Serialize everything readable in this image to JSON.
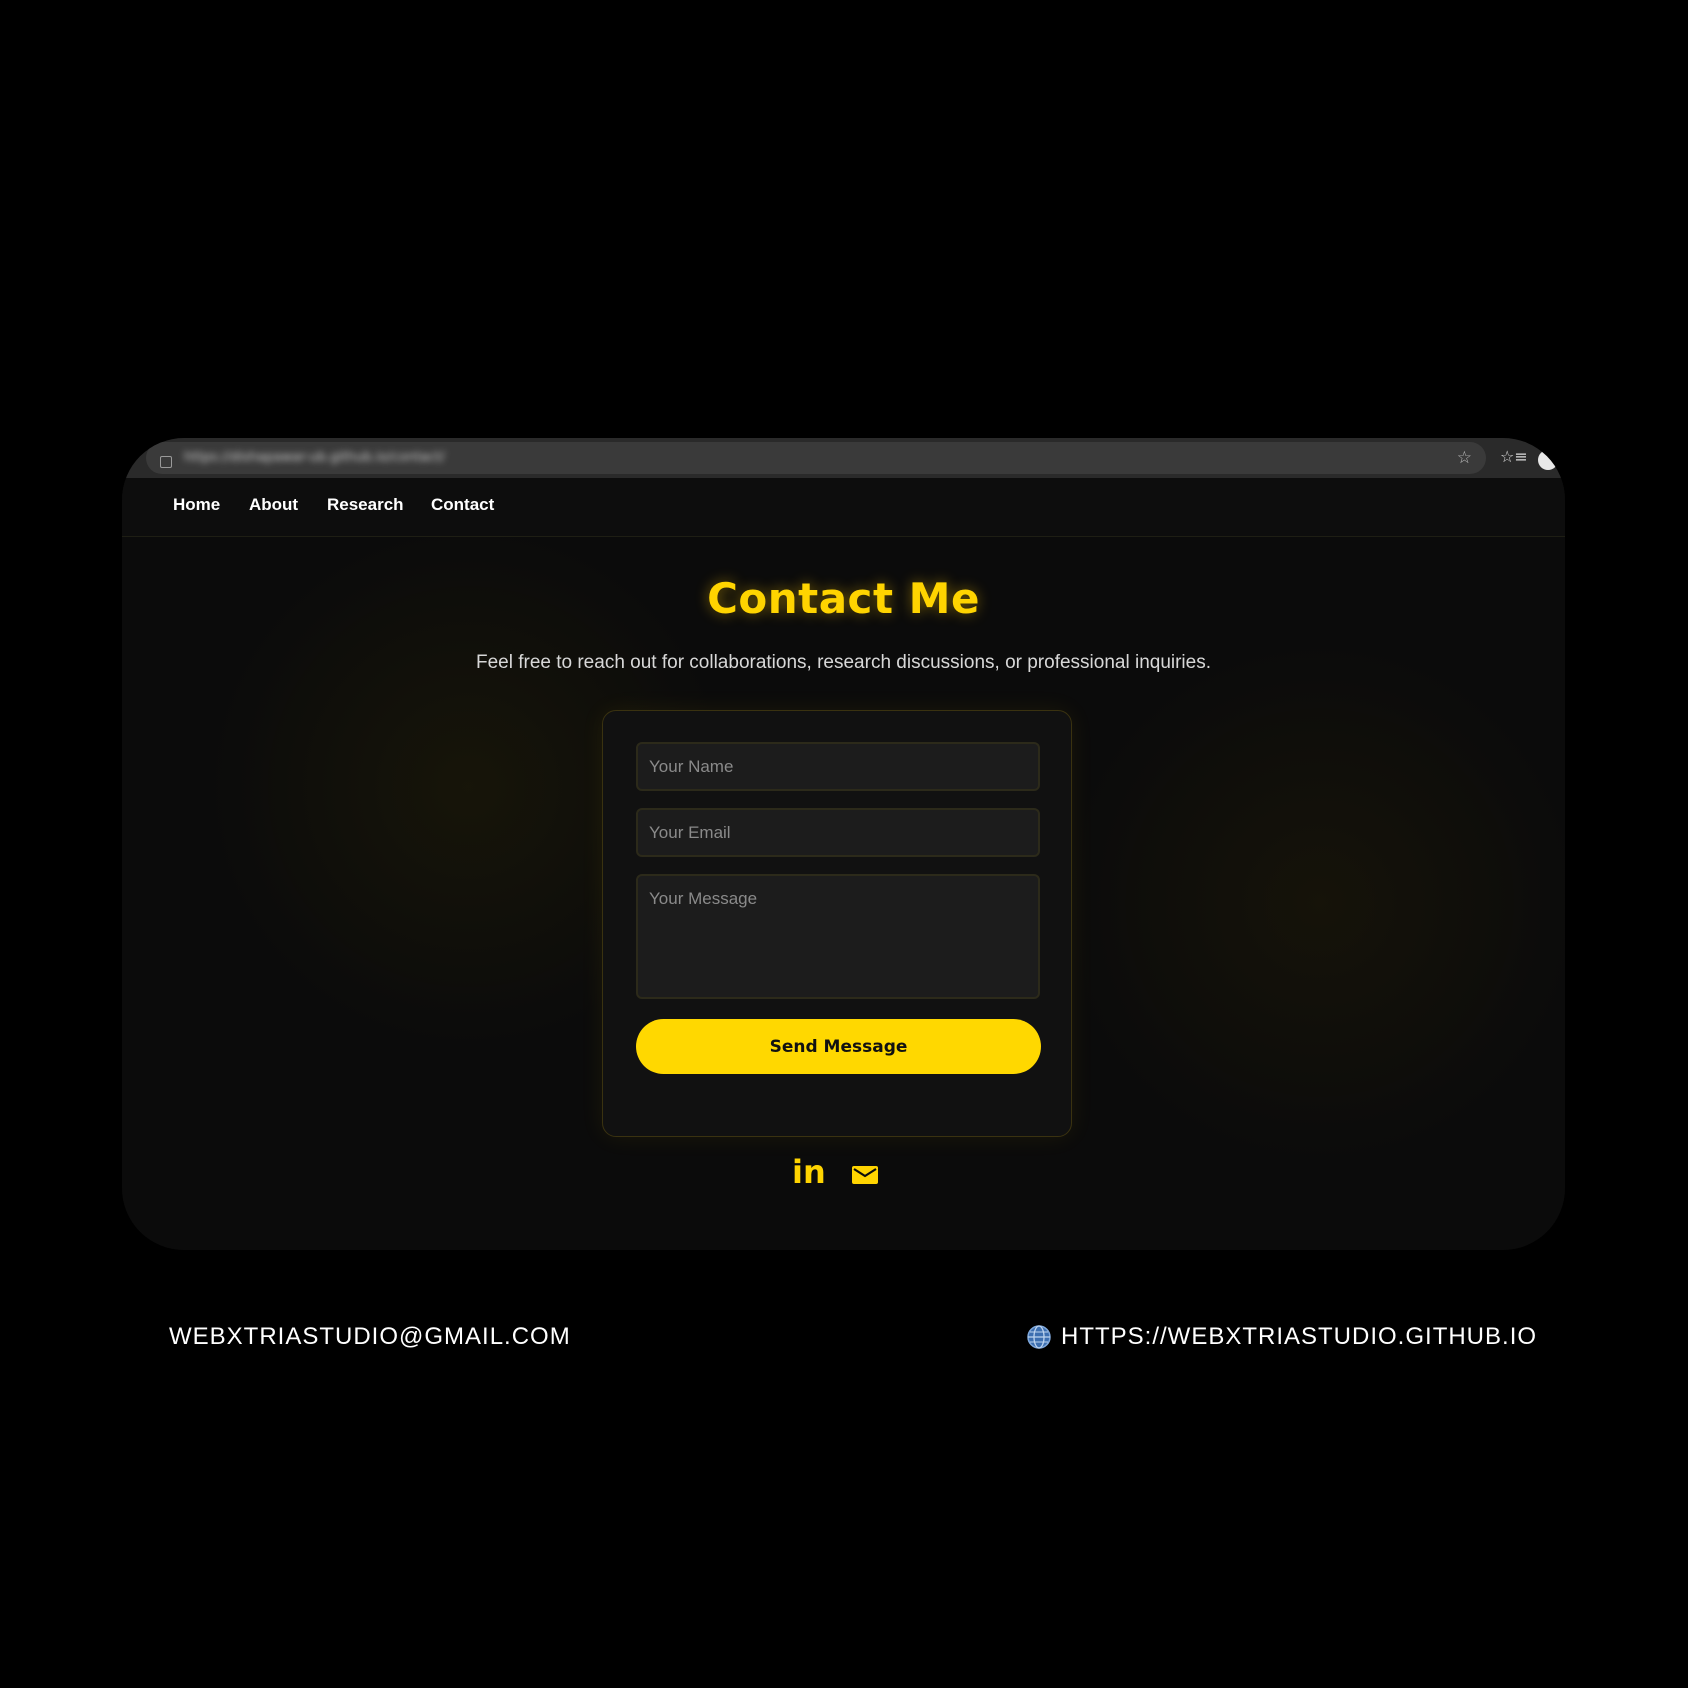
{
  "browser": {
    "url": "https://dishapawar-ub.github.io/contact/",
    "icons": {
      "tab": "page-icon",
      "bookmark": "star-icon",
      "favorites": "favorites-list-icon",
      "profile": "profile-icon"
    }
  },
  "nav": {
    "items": [
      {
        "label": "Home"
      },
      {
        "label": "About"
      },
      {
        "label": "Research"
      },
      {
        "label": "Contact"
      }
    ]
  },
  "main": {
    "title": "Contact Me",
    "subtitle": "Feel free to reach out for collaborations, research discussions, or professional inquiries."
  },
  "form": {
    "name_placeholder": "Your Name",
    "email_placeholder": "Your Email",
    "message_placeholder": "Your Message",
    "submit_label": "Send Message"
  },
  "social": {
    "linkedin_glyph": "in",
    "icons": [
      "linkedin-icon",
      "mail-icon"
    ]
  },
  "footer": {
    "email": "WEBXTRIASTUDIO@GMAIL.COM",
    "website": "HTTPS://WEBXTRIASTUDIO.GITHUB.IO"
  },
  "colors": {
    "accent": "#ffd400",
    "background": "#000000",
    "page_bg": "#0b0b0b",
    "card_bg": "#111111",
    "field_bg": "#1c1c1c"
  }
}
